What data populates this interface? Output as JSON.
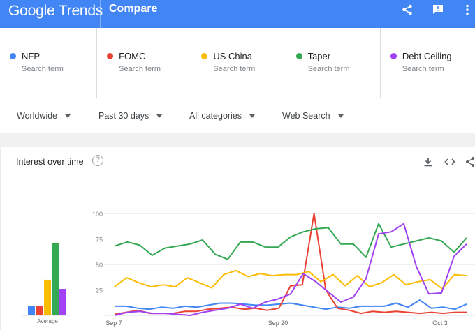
{
  "header": {
    "logo_google": "Google",
    "logo_trends": "Trends",
    "title": "Compare"
  },
  "terms": [
    {
      "label": "NFP",
      "sublabel": "Search term",
      "color": "#4285f4"
    },
    {
      "label": "FOMC",
      "sublabel": "Search term",
      "color": "#ea4335"
    },
    {
      "label": "US China",
      "sublabel": "Search term",
      "color": "#fbbc04"
    },
    {
      "label": "Taper",
      "sublabel": "Search term",
      "color": "#34a853"
    },
    {
      "label": "Debt Ceiling",
      "sublabel": "Search term",
      "color": "#a142f4"
    }
  ],
  "filters": {
    "region": "Worldwide",
    "period": "Past 30 days",
    "category": "All categories",
    "search_type": "Web Search"
  },
  "card": {
    "title": "Interest over time",
    "help": "?"
  },
  "chart_data": {
    "type": "line",
    "title": "Interest over time",
    "y_ticks": [
      "100",
      "75",
      "50",
      "25"
    ],
    "x_tick_labels": [
      "Sep 7",
      "Sep 20",
      "Oct 3"
    ],
    "ylim": [
      0,
      100
    ],
    "grid": true,
    "average_label": "Average",
    "average_values": {
      "NFP": 9,
      "FOMC": 9,
      "US China": 35,
      "Taper": 71,
      "Debt Ceiling": 26
    },
    "series": [
      {
        "name": "NFP",
        "color": "#4285f4",
        "values": [
          9,
          9,
          7,
          6,
          8,
          7,
          9,
          8,
          10,
          12,
          12,
          11,
          10,
          10,
          11,
          12,
          10,
          8,
          6,
          8,
          7,
          9,
          9,
          9,
          12,
          8,
          15,
          7,
          8,
          6,
          11
        ]
      },
      {
        "name": "FOMC",
        "color": "#ea4335",
        "values": [
          1,
          3,
          5,
          2,
          2,
          2,
          4,
          4,
          6,
          7,
          8,
          6,
          7,
          5,
          7,
          29,
          30,
          100,
          25,
          7,
          5,
          2,
          4,
          3,
          4,
          3,
          2,
          3,
          2,
          3,
          3
        ]
      },
      {
        "name": "US China",
        "color": "#fbbc04",
        "values": [
          28,
          37,
          32,
          28,
          30,
          28,
          37,
          32,
          27,
          40,
          44,
          38,
          41,
          39,
          40,
          40,
          43,
          33,
          40,
          29,
          39,
          28,
          32,
          40,
          30,
          33,
          35,
          26,
          40,
          39
        ]
      },
      {
        "name": "Taper",
        "color": "#34a853",
        "values": [
          68,
          72,
          69,
          59,
          66,
          68,
          70,
          74,
          60,
          55,
          72,
          72,
          67,
          67,
          77,
          82,
          85,
          86,
          70,
          70,
          57,
          90,
          67,
          70,
          73,
          76,
          73,
          62,
          76
        ]
      },
      {
        "name": "Debt Ceiling",
        "color": "#a142f4",
        "values": [
          0,
          3,
          4,
          2,
          2,
          1,
          0,
          3,
          5,
          7,
          11,
          7,
          13,
          16,
          21,
          41,
          33,
          23,
          13,
          18,
          36,
          80,
          82,
          90,
          48,
          21,
          22,
          58,
          70
        ]
      }
    ]
  }
}
